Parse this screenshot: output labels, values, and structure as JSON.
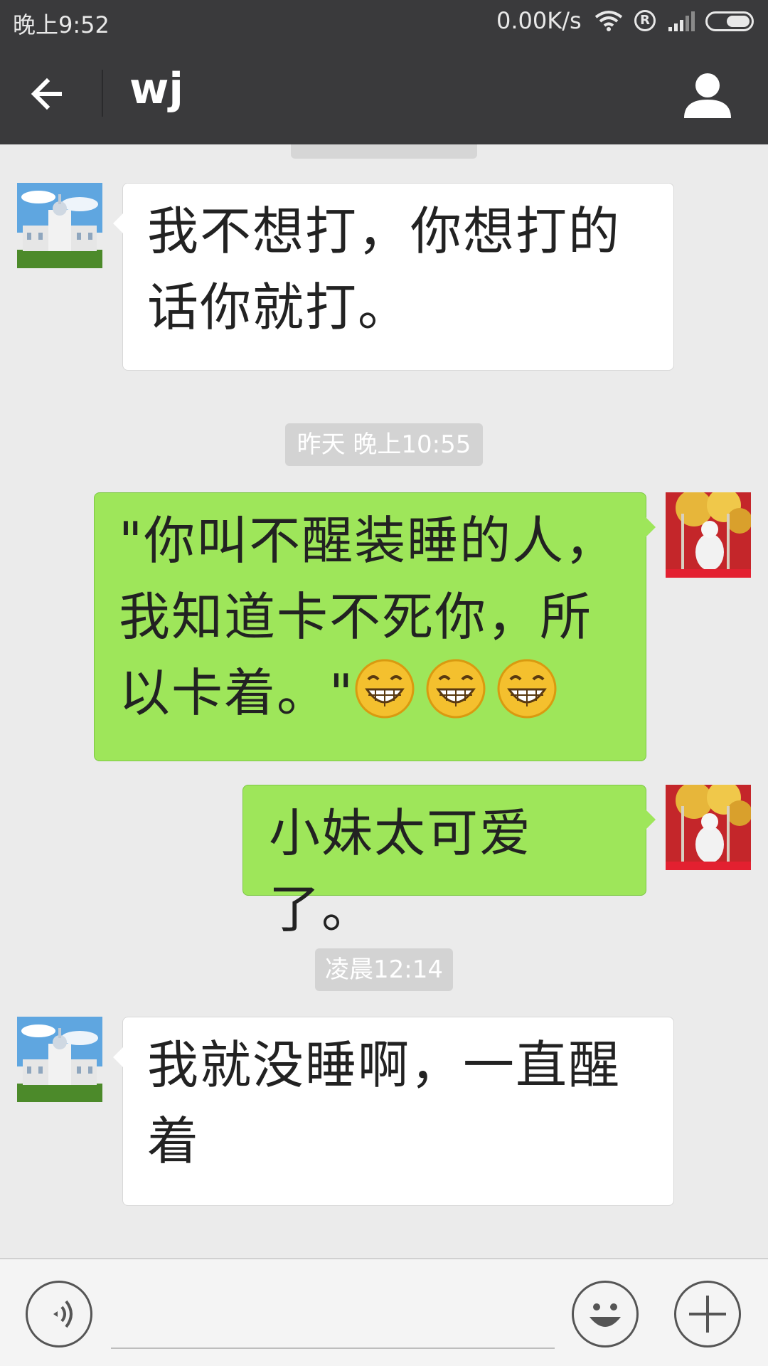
{
  "status_bar": {
    "time": "晚上9:52",
    "network_speed": "0.00K/s",
    "registered_symbol": "R",
    "icons": [
      "wifi-icon",
      "registered-icon",
      "signal-icon",
      "battery-icon"
    ]
  },
  "title_bar": {
    "title": "wj",
    "icons": [
      "back-arrow-icon",
      "profile-icon"
    ]
  },
  "messages": [
    {
      "side": "received",
      "text": "我不想打，你想打的话你就打。"
    },
    {
      "timestamp": "昨天 晚上10:55"
    },
    {
      "side": "sent",
      "text": "\"你叫不醒装睡的人，我知道卡不死你，所以卡着。\"",
      "emoji": [
        "grinning-face-icon",
        "grinning-face-icon",
        "grinning-face-icon"
      ]
    },
    {
      "side": "sent",
      "text": "小妹太可爱了。"
    },
    {
      "timestamp": "凌晨12:14"
    },
    {
      "side": "received",
      "text": "我就没睡啊，一直醒着"
    }
  ],
  "bottom_bar": {
    "input_value": "",
    "icons": [
      "voice-icon",
      "emoji-icon",
      "add-icon"
    ]
  },
  "colors": {
    "header": "#3a3a3c",
    "chat_background": "#ebebeb",
    "sent_bubble": "#9ee65a",
    "received_bubble": "#ffffff",
    "timestamp_badge": "#d3d3d3"
  }
}
